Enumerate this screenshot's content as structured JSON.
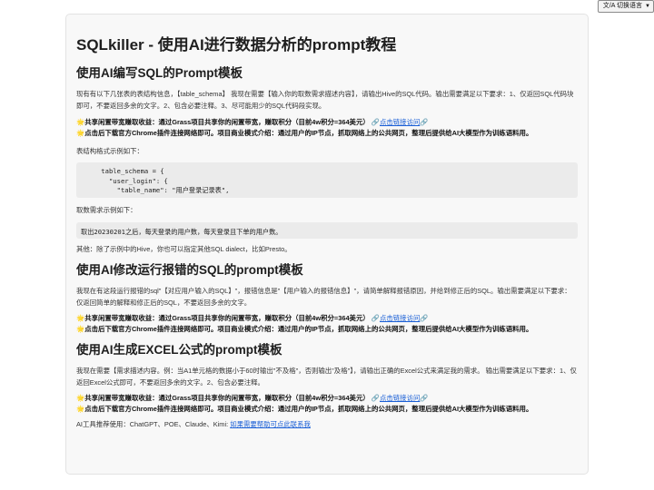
{
  "language_select": {
    "label": "文/A 切换语言",
    "chevron": "chevron-down-icon"
  },
  "page": {
    "title": "SQLkiller - 使用AI进行数据分析的prompt教程",
    "section1": {
      "heading": "使用AI编写SQL的Prompt模板",
      "intro": "现有有以下几张表的表结构信息，【table_schema】 我现在需要【输入你的取数需求描述内容】，请输出Hive的SQL代码。输出需要满足以下要求：1、仅返回SQL代码块即可，不要返回多余的文字。2、包含必要注释。3、尽可能用少的SQL代码段实现。",
      "note1_text": "共享闲置带宽赚取收益：通过Grass项目共享你的闲置带宽，赚取积分（目前4w积分=364美元）",
      "note1_link": "点击链接访问",
      "note2_text": "点击后下载官方Chrome插件连接网络即可。项目商业模式介绍：通过用户的IP节点，抓取网络上的公共网页，整理后提供给AI大模型作为训练语料用。",
      "schema_label": "表结构格式示例如下：",
      "schema_code": "    table_schema = {\n      \"user_login\": {\n        \"table_name\": \"用户登录记录表\",",
      "demand_label": "取数需求示例如下：",
      "demand_code": "取出20230201之后，每天登录的用户数，每天登录且下单的用户数。",
      "other": "其他：除了示例中的Hive，你也可以指定其他SQL dialect，比如Presto。"
    },
    "section2": {
      "heading": "使用AI修改运行报错的SQL的prompt模板",
      "intro": "我现在有这段运行报错的sql\"【对应用户输入的SQL】\"，报错信息是\"【用户输入的报错信息】\"，请简单解释报错原因，并给到修正后的SQL。输出需要满足以下要求：仅返回简单的解释和修正后的SQL，不要返回多余的文字。",
      "note1_text": "共享闲置带宽赚取收益：通过Grass项目共享你的闲置带宽，赚取积分（目前4w积分=364美元）",
      "note1_link": "点击链接访问",
      "note2_text": "点击后下载官方Chrome插件连接网络即可。项目商业模式介绍：通过用户的IP节点，抓取网络上的公共网页，整理后提供给AI大模型作为训练语料用。"
    },
    "section3": {
      "heading": "使用AI生成EXCEL公式的prompt模板",
      "intro": "我现在需要【需求描述内容。例：当A1单元格的数据小于60时输出\"不及格\"，否则输出\"及格\"】，请输出正确的Excel公式来满足我的需求。 输出需要满足以下要求：1、仅返回Excel公式即可，不要返回多余的文字。2、包含必要注释。",
      "note1_text": "共享闲置带宽赚取收益：通过Grass项目共享你的闲置带宽，赚取积分（目前4w积分=364美元）",
      "note1_link": "点击链接访问",
      "note2_text": "点击后下载官方Chrome插件连接网络即可。项目商业模式介绍：通过用户的IP节点，抓取网络上的公共网页，整理后提供给AI大模型作为训练语料用。"
    },
    "tools_label": "AI工具推荐使用：ChatGPT、POE、Claude、Kimi: ",
    "tools_link": "如果需要帮助可点此联系我"
  },
  "icons": {
    "star": "🌟",
    "link": "🔗"
  },
  "colors": {
    "link": "#1a5fd6",
    "star": "#f2b100",
    "card_bg": "#f8f8f8",
    "code_bg": "#ebebeb"
  }
}
